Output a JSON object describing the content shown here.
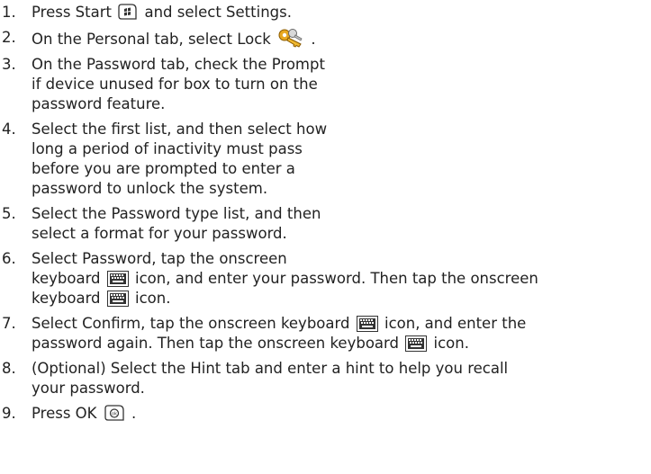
{
  "steps": [
    {
      "number": "1.",
      "line1_before": "Press Start",
      "line1_icon": "windows-start-button-icon",
      "line1_after": "and select Settings."
    },
    {
      "number": "2.",
      "line1_before": "On the Personal tab, select Lock",
      "line1_icon": "lock-keys-icon",
      "line1_after": "."
    },
    {
      "number": "3.",
      "lines": [
        "On the Password tab, check the Prompt",
        "if device unused for box to turn on the",
        "password feature."
      ]
    },
    {
      "number": "4.",
      "lines": [
        "Select the first list, and then select how",
        "long a period of inactivity must pass",
        "before you are prompted to enter a",
        "password to unlock the system."
      ]
    },
    {
      "number": "5.",
      "lines": [
        "Select the Password type list, and then",
        "select a format for your password."
      ]
    },
    {
      "number": "6.",
      "line1": "Select Password, tap the onscreen",
      "line2_before": "keyboard",
      "line2_icon": "keyboard-icon",
      "line2_after": "icon, and enter your password. Then tap the onscreen",
      "line3_before": "keyboard",
      "line3_icon": "keyboard-icon",
      "line3_after": "icon."
    },
    {
      "number": "7.",
      "line1_before": "Select Confirm, tap the onscreen keyboard",
      "line1_icon": "keyboard-icon",
      "line1_after": "icon, and enter the",
      "line2_before": "password again. Then tap the onscreen keyboard",
      "line2_icon": "keyboard-icon",
      "line2_after": "icon."
    },
    {
      "number": "8.",
      "lines": [
        "(Optional) Select the Hint tab and enter a hint to help you recall",
        "your password."
      ]
    },
    {
      "number": "9.",
      "line1_before": "Press OK",
      "line1_icon": "ok-button-icon",
      "line1_after": "."
    }
  ]
}
